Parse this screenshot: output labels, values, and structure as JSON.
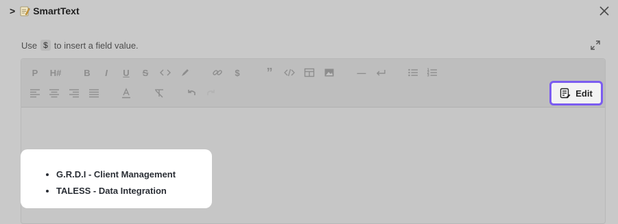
{
  "header": {
    "chevron": ">",
    "title": "SmartText"
  },
  "hint": {
    "before": "Use",
    "kbd": "$",
    "after": "to insert a field value."
  },
  "toolbar": {
    "paragraph_label": "P",
    "heading_label": "H#",
    "bold_label": "B",
    "italic_label": "I",
    "underline_label": "U",
    "strike_label": "S",
    "variable_label": "$",
    "quote_label": "”",
    "hr_label": "—"
  },
  "edit_button": {
    "label": "Edit"
  },
  "content": {
    "items": [
      "G.R.D.I - Client Management",
      "TALESS - Data Integration"
    ]
  },
  "colors": {
    "accent": "#7b5cf0",
    "overlay": "#c9c9c9"
  }
}
